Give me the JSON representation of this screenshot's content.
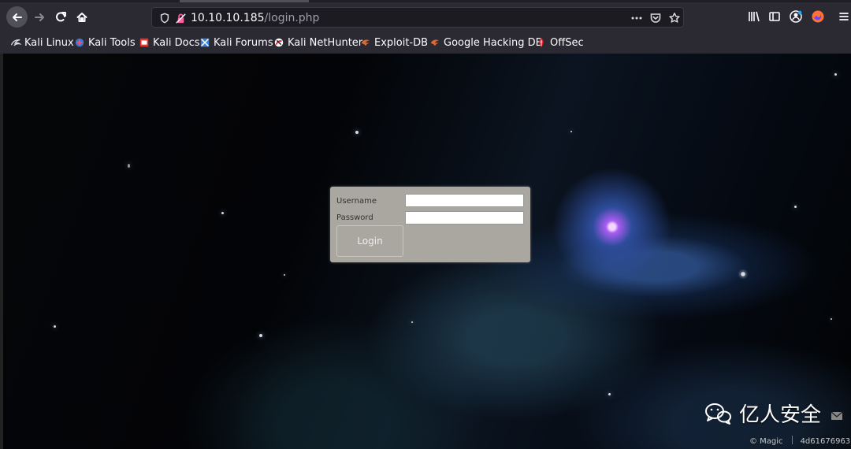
{
  "browser": {
    "url": {
      "host": "10.10.10.185",
      "path": "/login.php"
    },
    "toolbar": {
      "back_icon": "back-arrow-icon",
      "forward_icon": "forward-arrow-icon",
      "reload_icon": "reload-icon",
      "home_icon": "home-icon",
      "tracking_icon": "tracking-protection-icon",
      "insecure_icon": "insecure-connection-icon",
      "more_icon": "more-actions-icon",
      "pocket_icon": "pocket-icon",
      "bookmark_icon": "bookmark-star-icon",
      "library_icon": "library-icon",
      "sidebar_icon": "sidebar-icon",
      "account_icon": "account-icon",
      "extension_icon": "firefox-extension-icon",
      "menu_icon": "hamburger-menu-icon"
    },
    "bookmarks": [
      {
        "label": "Kali Linux",
        "icon": "kali-linux-icon"
      },
      {
        "label": "Kali Tools",
        "icon": "kali-tools-icon"
      },
      {
        "label": "Kali Docs",
        "icon": "kali-docs-icon"
      },
      {
        "label": "Kali Forums",
        "icon": "kali-forums-icon"
      },
      {
        "label": "Kali NetHunter",
        "icon": "kali-nethunter-icon"
      },
      {
        "label": "Exploit-DB",
        "icon": "exploit-db-icon"
      },
      {
        "label": "Google Hacking DB",
        "icon": "google-hacking-db-icon"
      },
      {
        "label": "OffSec",
        "icon": "offsec-icon"
      }
    ]
  },
  "login": {
    "username_label": "Username",
    "password_label": "Password",
    "username_value": "",
    "password_value": "",
    "button_label": "Login"
  },
  "watermark": {
    "brand": "亿人安全",
    "credit": "© Magic",
    "id": "4d61676963"
  },
  "colors": {
    "toolbar": "#2b2a33",
    "login_panel": "#aaa7a0",
    "space_accent": "#a95cf2"
  }
}
